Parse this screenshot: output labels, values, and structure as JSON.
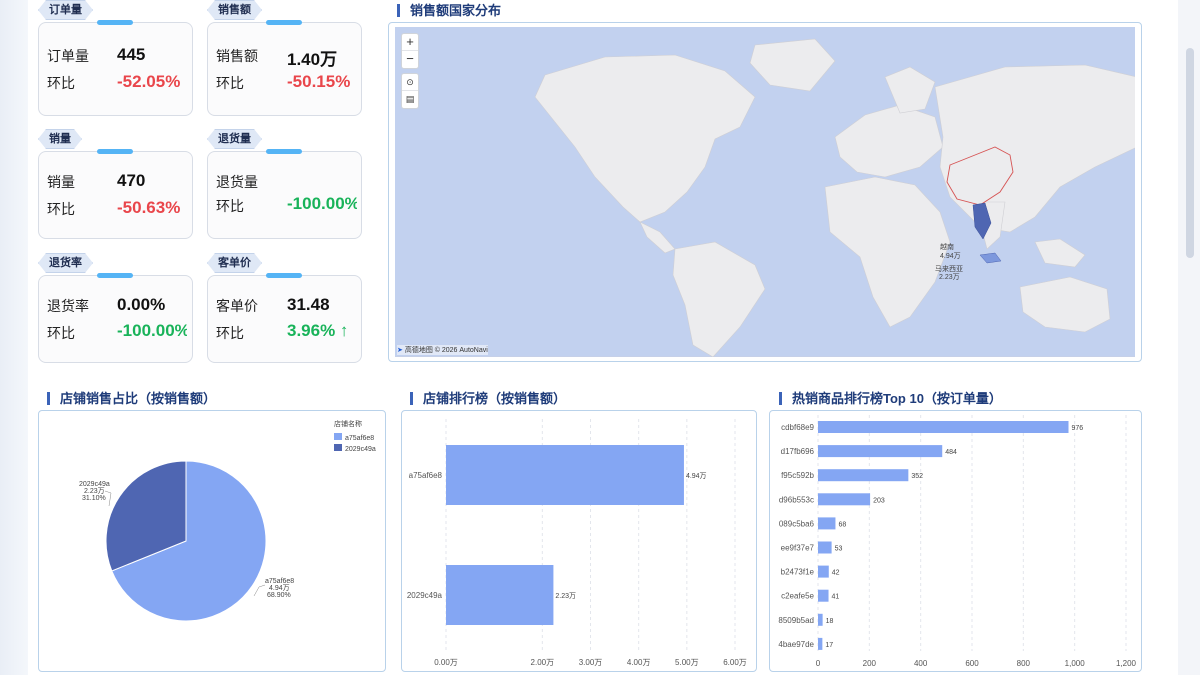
{
  "kpis": {
    "orders": {
      "tag": "订单量",
      "label": "订单量",
      "value": "445",
      "mom_label": "环比",
      "mom": "-52.05%"
    },
    "sales": {
      "tag": "销售额",
      "label": "销售额",
      "value": "1.40万",
      "mom_label": "环比",
      "mom": "-50.15%"
    },
    "volume": {
      "tag": "销量",
      "label": "销量",
      "value": "470",
      "mom_label": "环比",
      "mom": "-50.63%"
    },
    "returns": {
      "tag": "退货量",
      "label": "退货量",
      "value": "",
      "mom_label": "环比",
      "mom": "-100.00%"
    },
    "return_rate": {
      "tag": "退货率",
      "label": "退货率",
      "value": "0.00%",
      "mom_label": "环比",
      "mom": "-100.00%"
    },
    "aov": {
      "tag": "客单价",
      "label": "客单价",
      "value": "31.48",
      "mom_label": "环比",
      "mom": "3.96%"
    }
  },
  "colors": {
    "down": "#e9464b",
    "up": "#19b35a",
    "accent": "#3b63b8",
    "bar": "#84a6f3",
    "bar_dark": "#4f66b2"
  },
  "map": {
    "title": "销售额国家分布",
    "zoom_in": "+",
    "zoom_out": "−",
    "attribution": "高德地图 © 2026 AutoNavi",
    "labels": [
      {
        "name": "越南",
        "value": "4.94万"
      },
      {
        "name": "马来西亚",
        "value": "2.23万"
      }
    ]
  },
  "pie": {
    "title": "店铺销售占比（按销售额）",
    "legend_title": "店铺名称",
    "slices": [
      {
        "name": "a75af6e8",
        "value": "4.94万",
        "pct": "68.90%",
        "share": 68.9,
        "color": "#84a6f3"
      },
      {
        "name": "2029c49a",
        "value": "2.23万",
        "pct": "31.10%",
        "share": 31.1,
        "color": "#4f66b2"
      }
    ]
  },
  "store_rank": {
    "title": "店铺排行榜（按销售额）",
    "chart_data": {
      "type": "bar",
      "orientation": "horizontal",
      "categories": [
        "a75af6e8",
        "2029c49a"
      ],
      "values": [
        4.94,
        2.23
      ],
      "value_labels": [
        "4.94万",
        "2.23万"
      ],
      "xlim": [
        0,
        6
      ],
      "x_ticks": [
        "0.00万",
        "2.00万",
        "3.00万",
        "4.00万",
        "5.00万",
        "6.00万"
      ]
    }
  },
  "top_products": {
    "title": "热销商品排行榜Top 10（按订单量）",
    "chart_data": {
      "type": "bar",
      "orientation": "horizontal",
      "categories": [
        "cdbf68e9",
        "d17fb696",
        "f95c592b",
        "d96b553c",
        "089c5ba6",
        "ee9f37e7",
        "b2473f1e",
        "c2eafe5e",
        "8509b5ad",
        "4bae97de"
      ],
      "values": [
        976,
        484,
        352,
        203,
        68,
        53,
        42,
        41,
        18,
        17
      ],
      "xlim": [
        0,
        1200
      ],
      "x_ticks": [
        "0",
        "200",
        "400",
        "600",
        "800",
        "1,000",
        "1,200"
      ]
    }
  }
}
